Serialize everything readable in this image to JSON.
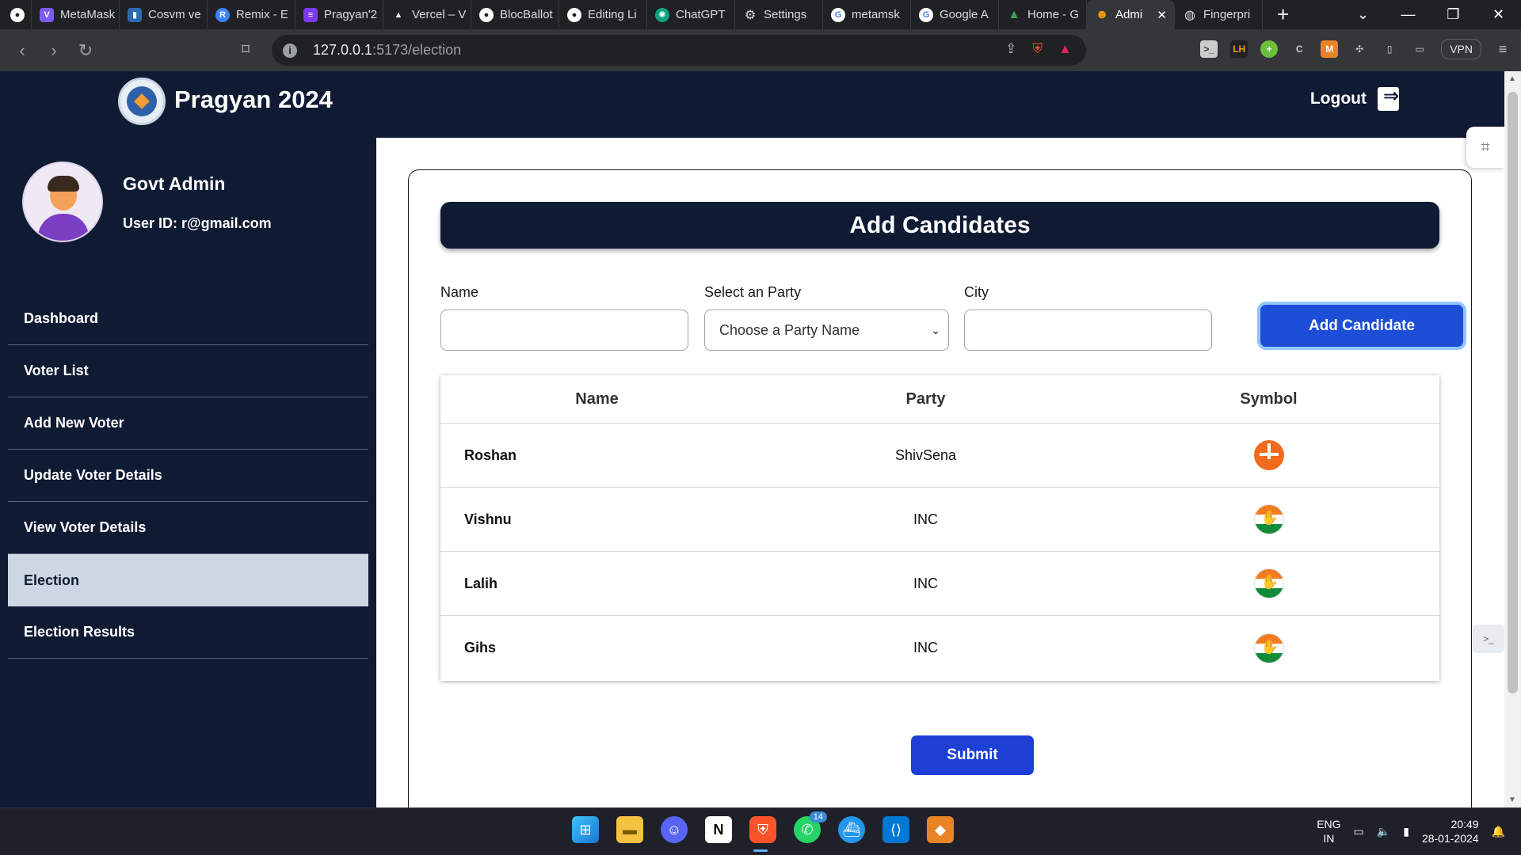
{
  "browser": {
    "tabs": [
      {
        "label": "",
        "icon": "github-icon",
        "color": "#202124"
      },
      {
        "label": "MetaMask",
        "icon": "vite-icon",
        "color": "#7e5bef"
      },
      {
        "label": "Cosvm ve",
        "icon": "cosvm-icon",
        "color": "#2b6cb0"
      },
      {
        "label": "Remix - E",
        "icon": "remix-icon",
        "color": "#3b82f6"
      },
      {
        "label": "Pragyan'2",
        "icon": "slides-icon",
        "color": "#7c3aed"
      },
      {
        "label": "Vercel – V",
        "icon": "vercel-icon",
        "color": "#000000"
      },
      {
        "label": "BlocBallot",
        "icon": "github-icon",
        "color": "#202124"
      },
      {
        "label": "Editing Li",
        "icon": "github-icon",
        "color": "#202124"
      },
      {
        "label": "ChatGPT",
        "icon": "chatgpt-icon",
        "color": "#10a37f"
      },
      {
        "label": "Settings",
        "icon": "gear-icon",
        "color": "#5f6368"
      },
      {
        "label": "metamsk",
        "icon": "google-icon",
        "color": "#4285f4"
      },
      {
        "label": "Google A",
        "icon": "google-icon",
        "color": "#4285f4"
      },
      {
        "label": "Home - G",
        "icon": "drive-icon",
        "color": "#34a853"
      },
      {
        "label": "Admi",
        "icon": "admin-icon",
        "color": "#f59e0b"
      },
      {
        "label": "Fingerpri",
        "icon": "globe-icon",
        "color": "#5f6368"
      }
    ],
    "active_tab_index": 13,
    "url_host": "127.0.0.1",
    "url_rest": ":5173/election",
    "vpn_label": "VPN"
  },
  "app": {
    "title": "Pragyan 2024",
    "logout_label": "Logout"
  },
  "user": {
    "name": "Govt Admin",
    "id_label": "User ID: r@gmail.com"
  },
  "sidebar": {
    "items": [
      {
        "label": "Dashboard"
      },
      {
        "label": "Voter List"
      },
      {
        "label": "Add New Voter"
      },
      {
        "label": "Update Voter Details"
      },
      {
        "label": "View Voter Details"
      },
      {
        "label": "Election"
      },
      {
        "label": "Election Results"
      }
    ],
    "active_index": 5
  },
  "form": {
    "heading": "Add Candidates",
    "name_label": "Name",
    "name_value": "",
    "party_label": "Select an Party",
    "party_value": "Choose a Party Name",
    "city_label": "City",
    "city_value": "",
    "add_button": "Add Candidate"
  },
  "table": {
    "headers": [
      "Name",
      "Party",
      "Symbol"
    ],
    "rows": [
      {
        "name": "Roshan",
        "party": "ShivSena",
        "symbol": "shivsena-symbol-icon"
      },
      {
        "name": "Vishnu",
        "party": "INC",
        "symbol": "inc-symbol-icon"
      },
      {
        "name": "Lalih",
        "party": "INC",
        "symbol": "inc-symbol-icon"
      },
      {
        "name": "Gihs",
        "party": "INC",
        "symbol": "inc-symbol-icon"
      }
    ]
  },
  "submit_label": "Submit",
  "taskbar": {
    "apps": [
      "windows-start-icon",
      "file-explorer-icon",
      "discord-icon",
      "notion-icon",
      "brave-icon",
      "whatsapp-icon",
      "docker-icon",
      "vscode-icon",
      "metamask-icon"
    ],
    "whatsapp_badge": "14",
    "lang_top": "ENG",
    "lang_bottom": "IN",
    "time": "20:49",
    "date": "28-01-2024"
  },
  "colors": {
    "navy": "#0f1a33",
    "accent_blue": "#1d4ed8",
    "active_menu": "#cdd7e3"
  }
}
